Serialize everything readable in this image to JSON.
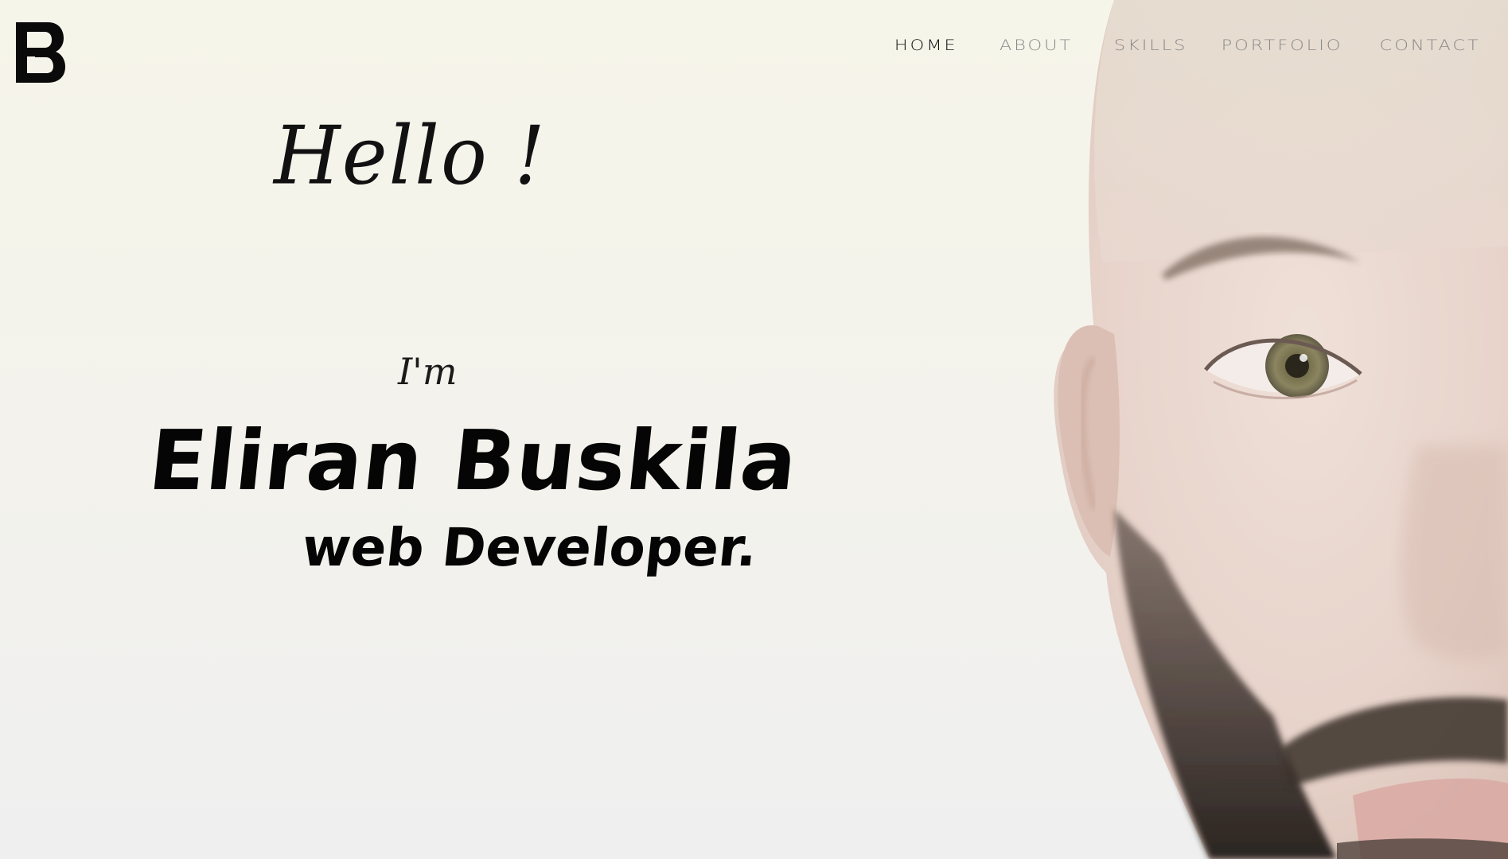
{
  "logo": {
    "icon": "eb-monogram-logo"
  },
  "nav": {
    "items": [
      {
        "label": "HOME",
        "active": true
      },
      {
        "label": "ABOUT",
        "active": false
      },
      {
        "label": "SKILLS",
        "active": false
      },
      {
        "label": "PORTFOLIO",
        "active": false
      },
      {
        "label": "CONTACT",
        "active": false
      }
    ]
  },
  "hero": {
    "greeting": "Hello !",
    "intro": "I'm",
    "name": "Eliran Buskila",
    "role": "web Developer."
  },
  "colors": {
    "text": "#0d0d0d",
    "nav_inactive": "#8a8a8a",
    "nav_active": "#111111",
    "background": "#f4f3ea"
  }
}
